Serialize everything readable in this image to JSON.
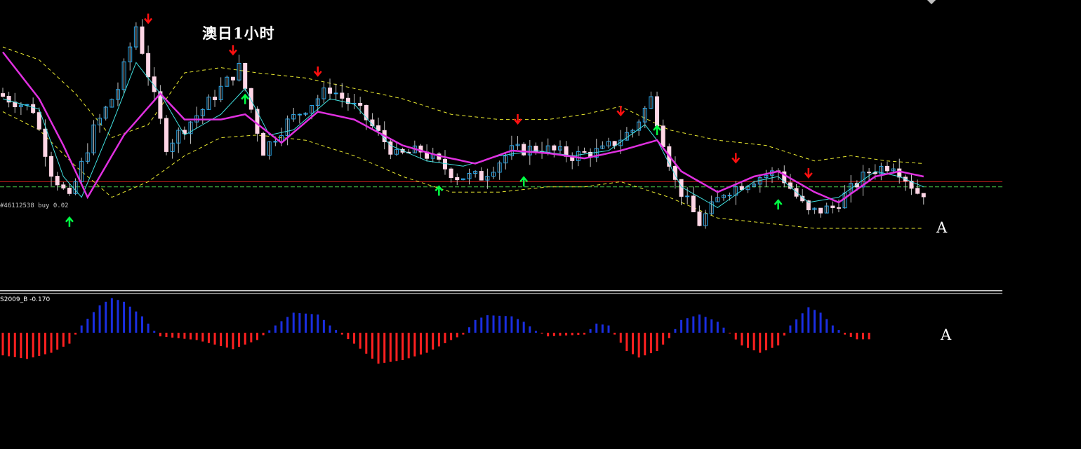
{
  "title": "澳日1小时",
  "order_label": "#46112538 buy 0.02",
  "indicator_label": "S2009_B -0.170",
  "marker_price": "A",
  "marker_indicator": "A",
  "colors": {
    "background": "#000000",
    "candle_up": "#2aa6e8",
    "candle_down": "#ffd6e6",
    "wick": "#c0c0c0",
    "ma_fast": "#40e0e0",
    "ma_slow": "#e030e0",
    "band": "#e8e830",
    "arrow_up": "#00ff44",
    "arrow_down": "#ff1010",
    "hist_pos": "#1a2ee0",
    "hist_neg": "#ff2020",
    "order_line": "#c81c1c",
    "order_dash": "#48c848",
    "separator": "#ffffff"
  },
  "icons": {
    "up": "up-arrow-icon",
    "down": "down-arrow-icon"
  },
  "chart_data": [
    {
      "type": "candlestick",
      "title": "澳日1小时",
      "ylim": [
        0,
        100
      ],
      "price_anchors": [
        [
          0,
          72
        ],
        [
          6,
          66
        ],
        [
          9,
          42
        ],
        [
          12,
          31
        ],
        [
          16,
          58
        ],
        [
          20,
          74
        ],
        [
          23,
          98
        ],
        [
          28,
          52
        ],
        [
          34,
          66
        ],
        [
          40,
          82
        ],
        [
          44,
          50
        ],
        [
          48,
          61
        ],
        [
          55,
          74
        ],
        [
          60,
          65
        ],
        [
          66,
          48
        ],
        [
          70,
          50
        ],
        [
          76,
          40
        ],
        [
          80,
          40
        ],
        [
          85,
          50
        ],
        [
          90,
          51
        ],
        [
          95,
          48
        ],
        [
          100,
          50
        ],
        [
          105,
          58
        ],
        [
          108,
          70
        ],
        [
          112,
          38
        ],
        [
          116,
          22
        ],
        [
          120,
          34
        ],
        [
          126,
          40
        ],
        [
          129,
          42
        ],
        [
          134,
          26
        ],
        [
          138,
          28
        ],
        [
          144,
          42
        ],
        [
          148,
          45
        ],
        [
          152,
          34
        ]
      ],
      "ma_fast_anchors": [
        [
          0,
          70
        ],
        [
          6,
          66
        ],
        [
          10,
          40
        ],
        [
          13,
          32
        ],
        [
          18,
          60
        ],
        [
          22,
          84
        ],
        [
          26,
          72
        ],
        [
          30,
          56
        ],
        [
          36,
          64
        ],
        [
          40,
          74
        ],
        [
          44,
          56
        ],
        [
          48,
          58
        ],
        [
          54,
          70
        ],
        [
          58,
          68
        ],
        [
          64,
          52
        ],
        [
          70,
          46
        ],
        [
          76,
          44
        ],
        [
          82,
          48
        ],
        [
          88,
          50
        ],
        [
          94,
          48
        ],
        [
          100,
          50
        ],
        [
          106,
          60
        ],
        [
          108,
          54
        ],
        [
          112,
          36
        ],
        [
          118,
          28
        ],
        [
          124,
          38
        ],
        [
          128,
          40
        ],
        [
          133,
          30
        ],
        [
          138,
          32
        ],
        [
          144,
          42
        ],
        [
          148,
          40
        ],
        [
          152,
          36
        ]
      ],
      "ma_slow_anchors": [
        [
          0,
          88
        ],
        [
          6,
          70
        ],
        [
          10,
          52
        ],
        [
          14,
          32
        ],
        [
          20,
          56
        ],
        [
          26,
          72
        ],
        [
          30,
          62
        ],
        [
          36,
          62
        ],
        [
          40,
          64
        ],
        [
          46,
          53
        ],
        [
          52,
          65
        ],
        [
          58,
          62
        ],
        [
          66,
          52
        ],
        [
          72,
          48
        ],
        [
          78,
          45
        ],
        [
          84,
          50
        ],
        [
          90,
          49
        ],
        [
          96,
          47
        ],
        [
          102,
          50
        ],
        [
          108,
          54
        ],
        [
          112,
          42
        ],
        [
          118,
          34
        ],
        [
          124,
          40
        ],
        [
          128,
          42
        ],
        [
          134,
          34
        ],
        [
          138,
          30
        ],
        [
          144,
          40
        ],
        [
          148,
          42
        ],
        [
          152,
          40
        ]
      ],
      "band_upper_anchors": [
        [
          0,
          90
        ],
        [
          6,
          85
        ],
        [
          12,
          72
        ],
        [
          18,
          55
        ],
        [
          24,
          60
        ],
        [
          30,
          80
        ],
        [
          36,
          82
        ],
        [
          42,
          80
        ],
        [
          50,
          78
        ],
        [
          58,
          74
        ],
        [
          66,
          70
        ],
        [
          74,
          64
        ],
        [
          82,
          62
        ],
        [
          90,
          62
        ],
        [
          96,
          64
        ],
        [
          102,
          67
        ],
        [
          110,
          58
        ],
        [
          118,
          54
        ],
        [
          126,
          52
        ],
        [
          134,
          46
        ],
        [
          140,
          48
        ],
        [
          146,
          46
        ],
        [
          152,
          45
        ]
      ],
      "band_lower_anchors": [
        [
          0,
          65
        ],
        [
          6,
          58
        ],
        [
          12,
          44
        ],
        [
          18,
          32
        ],
        [
          24,
          38
        ],
        [
          30,
          48
        ],
        [
          36,
          55
        ],
        [
          42,
          56
        ],
        [
          50,
          54
        ],
        [
          58,
          48
        ],
        [
          66,
          40
        ],
        [
          74,
          34
        ],
        [
          82,
          34
        ],
        [
          90,
          36
        ],
        [
          96,
          36
        ],
        [
          102,
          38
        ],
        [
          110,
          32
        ],
        [
          118,
          24
        ],
        [
          126,
          22
        ],
        [
          134,
          20
        ],
        [
          140,
          20
        ],
        [
          146,
          20
        ],
        [
          152,
          20
        ]
      ],
      "signals": [
        {
          "type": "sell",
          "bar": 24
        },
        {
          "type": "buy",
          "bar": 11
        },
        {
          "type": "sell",
          "bar": 38
        },
        {
          "type": "buy",
          "bar": 40
        },
        {
          "type": "sell",
          "bar": 52
        },
        {
          "type": "buy",
          "bar": 72
        },
        {
          "type": "sell",
          "bar": 85
        },
        {
          "type": "buy",
          "bar": 86
        },
        {
          "type": "sell",
          "bar": 102
        },
        {
          "type": "buy",
          "bar": 108
        },
        {
          "type": "sell",
          "bar": 121
        },
        {
          "type": "buy",
          "bar": 128
        },
        {
          "type": "sell",
          "bar": 133
        }
      ],
      "order_levels": {
        "red_line": 38,
        "green_dash": 36
      }
    },
    {
      "type": "bar",
      "title": "S2009_B -0.170",
      "hist_anchors": [
        [
          0,
          -0.62
        ],
        [
          4,
          -0.72
        ],
        [
          8,
          -0.55
        ],
        [
          11,
          -0.3
        ],
        [
          13,
          0.2
        ],
        [
          16,
          0.75
        ],
        [
          18,
          0.95
        ],
        [
          20,
          0.85
        ],
        [
          23,
          0.45
        ],
        [
          25,
          0.05
        ],
        [
          26,
          -0.1
        ],
        [
          32,
          -0.2
        ],
        [
          38,
          -0.45
        ],
        [
          42,
          -0.2
        ],
        [
          45,
          0.2
        ],
        [
          48,
          0.55
        ],
        [
          52,
          0.5
        ],
        [
          54,
          0.2
        ],
        [
          56,
          -0.05
        ],
        [
          58,
          -0.3
        ],
        [
          62,
          -0.85
        ],
        [
          66,
          -0.75
        ],
        [
          70,
          -0.55
        ],
        [
          74,
          -0.2
        ],
        [
          76,
          -0.05
        ],
        [
          78,
          0.35
        ],
        [
          80,
          0.48
        ],
        [
          84,
          0.45
        ],
        [
          86,
          0.3
        ],
        [
          88,
          0.05
        ],
        [
          90,
          -0.1
        ],
        [
          96,
          -0.05
        ],
        [
          98,
          0.25
        ],
        [
          100,
          0.2
        ],
        [
          101,
          -0.05
        ],
        [
          103,
          -0.5
        ],
        [
          105,
          -0.68
        ],
        [
          108,
          -0.5
        ],
        [
          110,
          -0.15
        ],
        [
          112,
          0.35
        ],
        [
          115,
          0.5
        ],
        [
          118,
          0.3
        ],
        [
          120,
          -0.02
        ],
        [
          122,
          -0.35
        ],
        [
          125,
          -0.55
        ],
        [
          128,
          -0.35
        ],
        [
          130,
          0.2
        ],
        [
          133,
          0.7
        ],
        [
          135,
          0.55
        ],
        [
          137,
          0.2
        ],
        [
          139,
          -0.05
        ],
        [
          141,
          -0.18
        ],
        [
          143,
          -0.18
        ]
      ]
    }
  ]
}
